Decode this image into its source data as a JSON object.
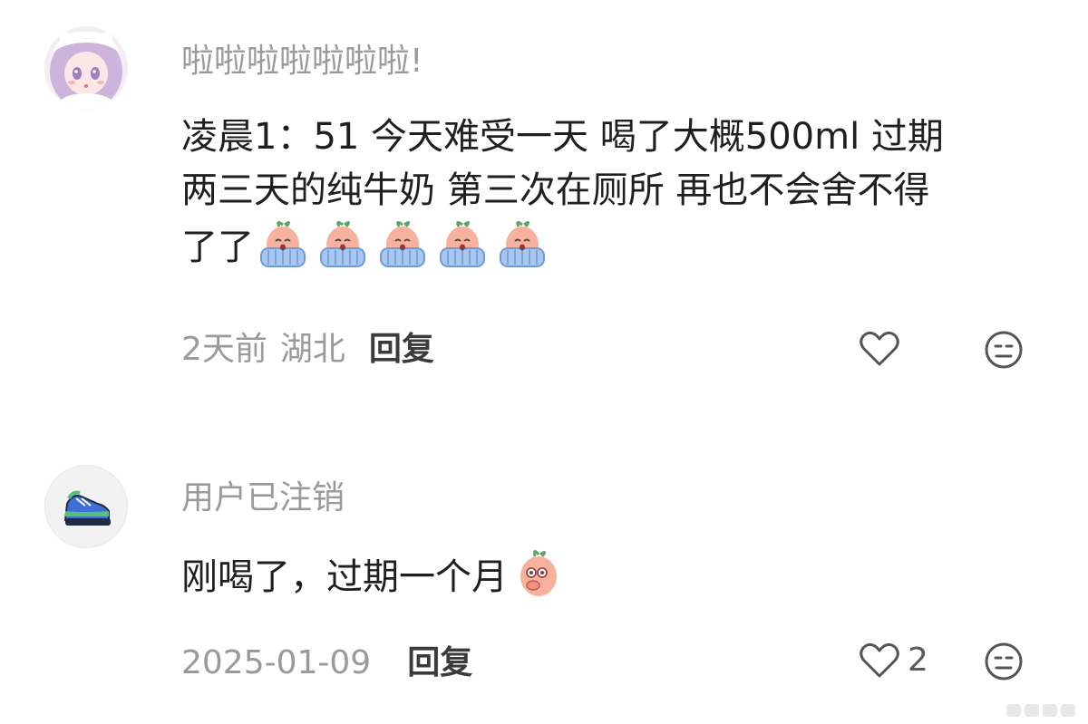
{
  "comments": [
    {
      "username": "啦啦啦啦啦啦啦!",
      "lines": [
        "凌晨1：51 今天难受一天 喝了大概500ml 过期",
        "两三天的纯牛奶 第三次在厕所 再也不会舍不得",
        "了了"
      ],
      "emoji_names": [
        "crying-face-emoji",
        "crying-face-emoji",
        "crying-face-emoji",
        "crying-face-emoji",
        "crying-face-emoji"
      ],
      "time": "2天前",
      "location": "湖北",
      "reply_label": "回复",
      "like_count": ""
    },
    {
      "username": "用户已注销",
      "lines": [
        "刚喝了，过期一个月"
      ],
      "emoji_names": [
        "covering-mouth-emoji"
      ],
      "time": "2025-01-09",
      "location": "",
      "reply_label": "回复",
      "like_count": "2"
    }
  ],
  "colors": {
    "username": "#9a9a9a",
    "text": "#1f1f1f",
    "meta": "#9a9a9a",
    "icon": "#555555"
  }
}
